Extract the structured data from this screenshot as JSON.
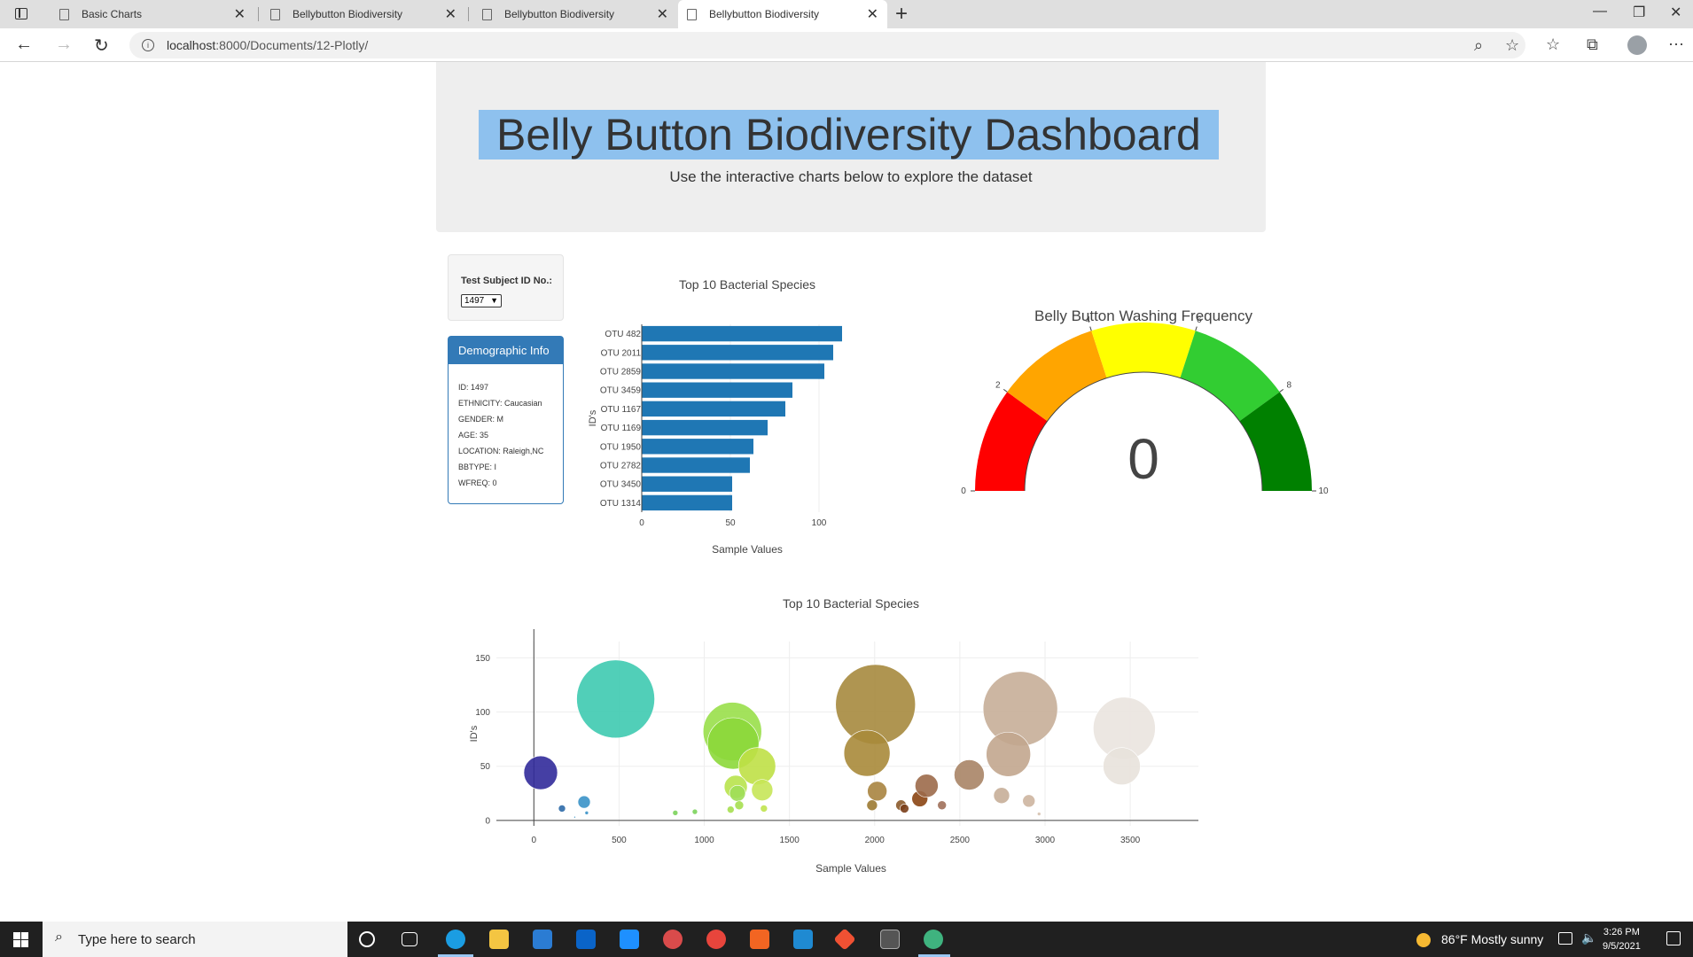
{
  "browser": {
    "tabs": [
      {
        "title": "Basic Charts"
      },
      {
        "title": "Bellybutton Biodiversity"
      },
      {
        "title": "Bellybutton Biodiversity"
      },
      {
        "title": "Bellybutton Biodiversity"
      }
    ],
    "url_host": "localhost",
    "url_rest": ":8000/Documents/12-Plotly/"
  },
  "header": {
    "title": "Belly Button Biodiversity Dashboard",
    "subtitle": "Use the interactive charts below to explore the dataset"
  },
  "selector": {
    "label": "Test Subject ID No.:",
    "selected": "1497"
  },
  "demographics": {
    "heading": "Demographic Info",
    "lines": [
      "ID: 1497",
      "ETHNICITY: Caucasian",
      "GENDER: M",
      "AGE: 35",
      "LOCATION: Raleigh,NC",
      "BBTYPE: I",
      "WFREQ: 0"
    ]
  },
  "chart_data": [
    {
      "type": "bar",
      "orientation": "horizontal",
      "title": "Top 10 Bacterial Species",
      "xlabel": "Sample Values",
      "ylabel": "ID's",
      "categories": [
        "OTU 482",
        "OTU 2011",
        "OTU 2859",
        "OTU 3459",
        "OTU 1167",
        "OTU 1169",
        "OTU 1950",
        "OTU 2782",
        "OTU 3450",
        "OTU 1314"
      ],
      "values": [
        113,
        108,
        103,
        85,
        81,
        71,
        63,
        61,
        51,
        51
      ],
      "xlim": [
        0,
        113
      ],
      "xticks": [
        0,
        50,
        100
      ],
      "color": "#1f77b4"
    },
    {
      "type": "gauge",
      "title": "Belly Button Washing Frequency",
      "value": 0,
      "value_label": "0",
      "range": [
        0,
        10
      ],
      "ticks": [
        0,
        2,
        4,
        6,
        8,
        10
      ],
      "steps": [
        {
          "range": [
            0,
            2
          ],
          "color": "#ff0000"
        },
        {
          "range": [
            2,
            4
          ],
          "color": "#ffa500"
        },
        {
          "range": [
            4,
            6
          ],
          "color": "#ffff00"
        },
        {
          "range": [
            6,
            8
          ],
          "color": "#32cd32"
        },
        {
          "range": [
            8,
            10
          ],
          "color": "#008000"
        }
      ]
    },
    {
      "type": "scatter",
      "subtype": "bubble",
      "title": "Top 10 Bacterial Species",
      "xlabel": "Sample Values",
      "ylabel": "ID's",
      "xlim": [
        -220,
        3900
      ],
      "ylim": [
        -5,
        165
      ],
      "xticks": [
        0,
        500,
        1000,
        1500,
        2000,
        2500,
        3000,
        3500
      ],
      "yticks": [
        0,
        50,
        100,
        150
      ],
      "grid": true,
      "points": [
        {
          "x": 40,
          "y": 44,
          "r": 19,
          "color": "#312a9a"
        },
        {
          "x": 165,
          "y": 11,
          "r": 4,
          "color": "#2e6aa8"
        },
        {
          "x": 295,
          "y": 17,
          "r": 7,
          "color": "#3a92c8"
        },
        {
          "x": 310,
          "y": 7,
          "r": 2,
          "color": "#3a92c8"
        },
        {
          "x": 240,
          "y": 3,
          "r": 1,
          "color": "#3a92c8"
        },
        {
          "x": 480,
          "y": 112,
          "r": 44,
          "color": "#3ecab0"
        },
        {
          "x": 830,
          "y": 7,
          "r": 3,
          "color": "#7bd35b"
        },
        {
          "x": 945,
          "y": 8,
          "r": 3,
          "color": "#7bd35b"
        },
        {
          "x": 1165,
          "y": 82,
          "r": 33,
          "color": "#99df4a"
        },
        {
          "x": 1170,
          "y": 71,
          "r": 29,
          "color": "#8cd83a"
        },
        {
          "x": 1310,
          "y": 50,
          "r": 21,
          "color": "#bfe046"
        },
        {
          "x": 1185,
          "y": 31,
          "r": 13,
          "color": "#b8e34c"
        },
        {
          "x": 1195,
          "y": 25,
          "r": 9,
          "color": "#9ede58"
        },
        {
          "x": 1340,
          "y": 28,
          "r": 12,
          "color": "#c6e558"
        },
        {
          "x": 1205,
          "y": 14,
          "r": 5,
          "color": "#a6df50"
        },
        {
          "x": 1350,
          "y": 11,
          "r": 4,
          "color": "#c0e34e"
        },
        {
          "x": 1155,
          "y": 10,
          "r": 4,
          "color": "#a6df50"
        },
        {
          "x": 2005,
          "y": 107,
          "r": 45,
          "color": "#a68a3e"
        },
        {
          "x": 1955,
          "y": 62,
          "r": 26,
          "color": "#a8893a"
        },
        {
          "x": 2015,
          "y": 27,
          "r": 11,
          "color": "#a98440"
        },
        {
          "x": 1985,
          "y": 14,
          "r": 6,
          "color": "#9c7a32"
        },
        {
          "x": 2155,
          "y": 14,
          "r": 6,
          "color": "#8b5a2b"
        },
        {
          "x": 2175,
          "y": 11,
          "r": 5,
          "color": "#7a3e1a"
        },
        {
          "x": 2265,
          "y": 20,
          "r": 9,
          "color": "#8b4513"
        },
        {
          "x": 2305,
          "y": 32,
          "r": 13,
          "color": "#9c6a4a"
        },
        {
          "x": 2395,
          "y": 14,
          "r": 5,
          "color": "#a0705a"
        },
        {
          "x": 2555,
          "y": 42,
          "r": 17,
          "color": "#a98466"
        },
        {
          "x": 2855,
          "y": 103,
          "r": 42,
          "color": "#c7ae98"
        },
        {
          "x": 2785,
          "y": 61,
          "r": 25,
          "color": "#c2a68e"
        },
        {
          "x": 2745,
          "y": 23,
          "r": 9,
          "color": "#c7ae98"
        },
        {
          "x": 2905,
          "y": 18,
          "r": 7,
          "color": "#cdb5a0"
        },
        {
          "x": 2965,
          "y": 6,
          "r": 2,
          "color": "#d6c2b0"
        },
        {
          "x": 3465,
          "y": 85,
          "r": 35,
          "color": "#eae4df"
        },
        {
          "x": 3450,
          "y": 50,
          "r": 21,
          "color": "#e8e2dc"
        }
      ]
    }
  ],
  "taskbar": {
    "search_placeholder": "Type here to search",
    "weather": "86°F  Mostly sunny",
    "time": "3:26 PM",
    "date": "9/5/2021"
  }
}
